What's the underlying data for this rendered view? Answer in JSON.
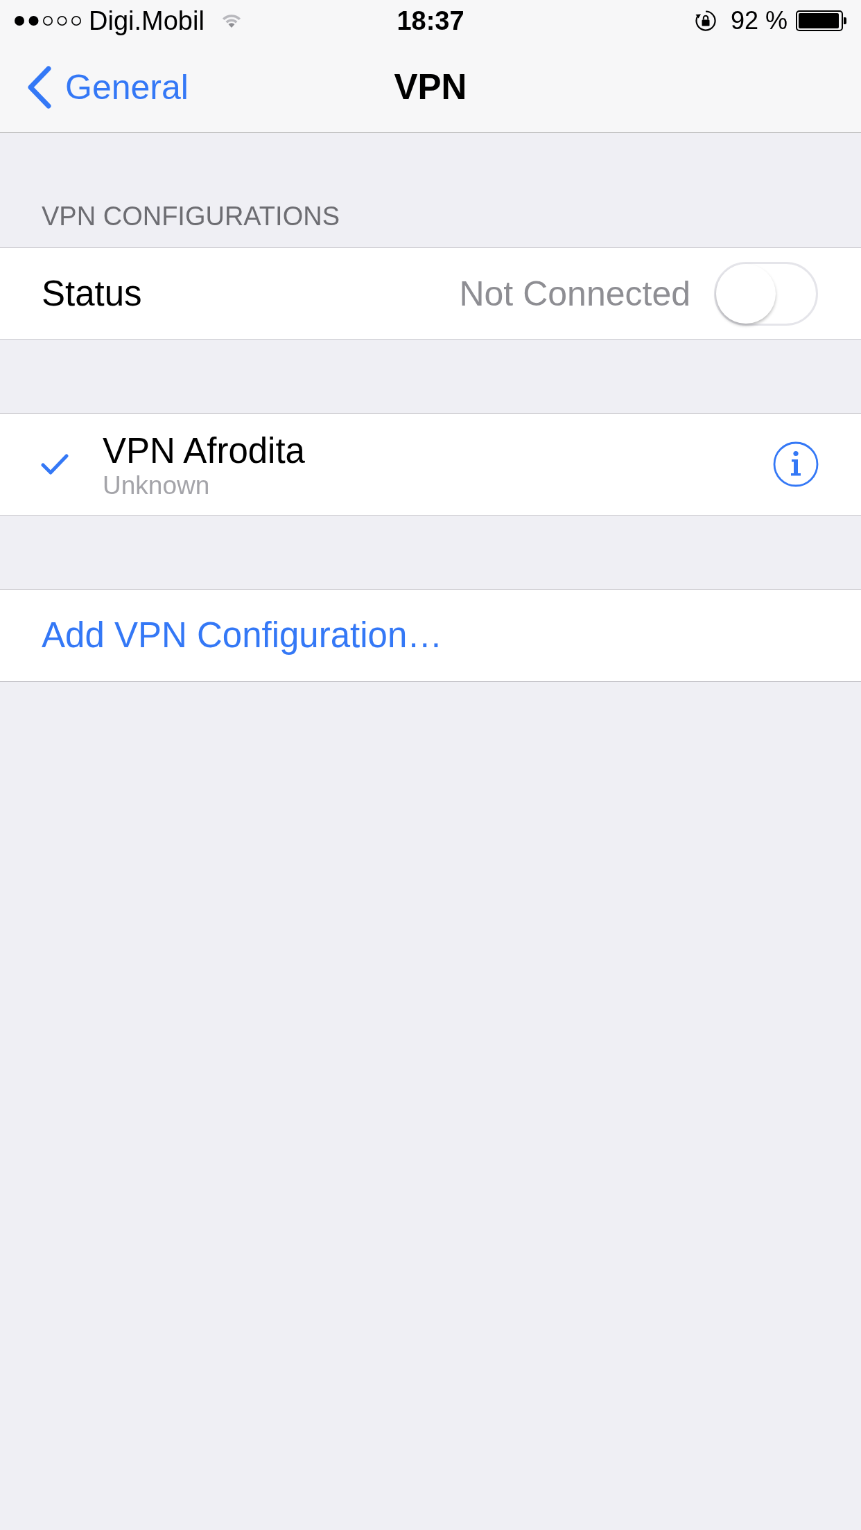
{
  "status_bar": {
    "carrier": "Digi.Mobil",
    "time": "18:37",
    "battery": "92 %"
  },
  "nav_bar": {
    "back": "General",
    "title": "VPN"
  },
  "sections": [
    {
      "header": "VPN CONFIGURATIONS",
      "rows": [
        {
          "kind": "toggle",
          "label": "Status",
          "value": "Not Connected",
          "on": false
        }
      ]
    },
    {
      "rows": [
        {
          "kind": "configuration",
          "title": "VPN Afrodita",
          "subtitle": "Unknown",
          "selected": true
        }
      ]
    },
    {
      "rows": [
        {
          "kind": "action",
          "label": "Add VPN Configuration…"
        }
      ]
    }
  ]
}
